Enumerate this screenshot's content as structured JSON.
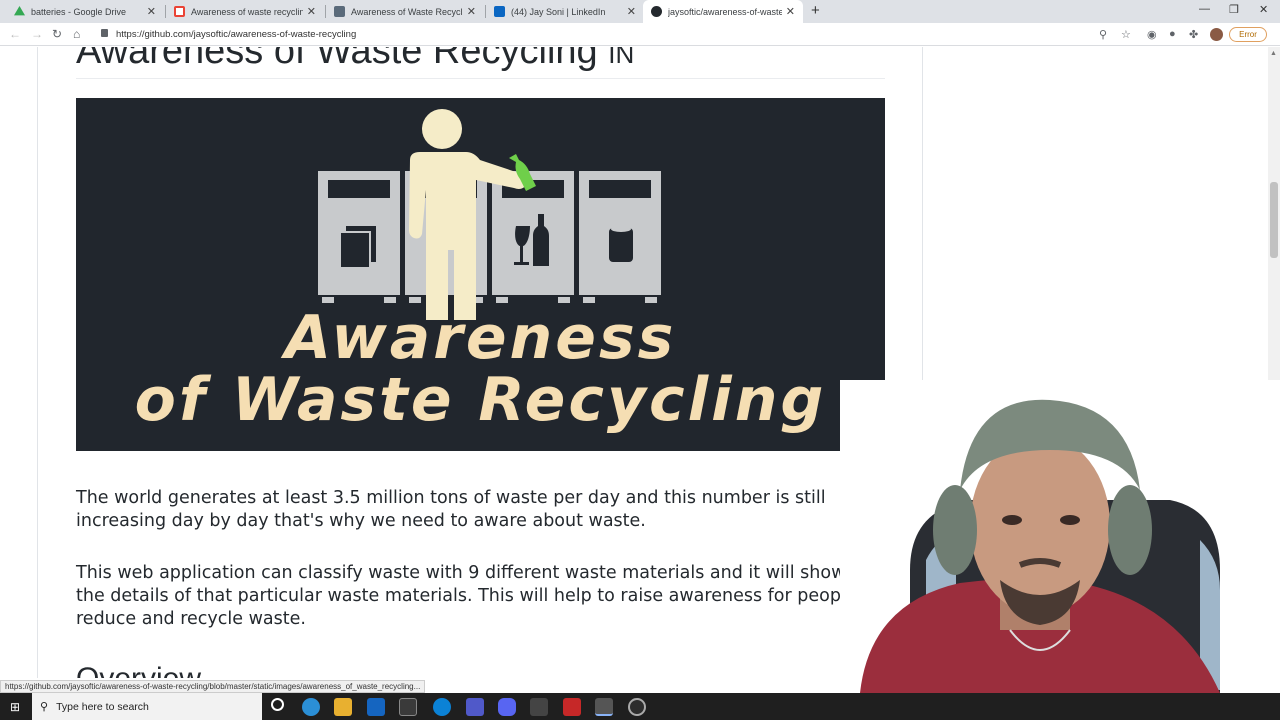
{
  "tabs": [
    {
      "title": "batteries - Google Drive",
      "icon": "google-drive-icon",
      "color": "#34a853"
    },
    {
      "title": "Awareness of waste recycling de",
      "icon": "gmail-icon",
      "color": "#ea4335"
    },
    {
      "title": "Awareness of Waste Recycling",
      "icon": "document-icon",
      "color": "#5a6a7a"
    },
    {
      "title": "(44) Jay Soni | LinkedIn",
      "icon": "linkedin-icon",
      "color": "#0a66c2"
    },
    {
      "title": "jaysoftic/awareness-of-waste-rec",
      "icon": "github-icon",
      "color": "#24292e"
    }
  ],
  "address_bar": {
    "url": "https://github.com/jaysoftic/awareness-of-waste-recycling",
    "error_label": "Error"
  },
  "page": {
    "heading": "Awareness of Waste Recycling",
    "heading_suffix": "IN",
    "banner": {
      "line1": "Awareness",
      "line2": "of Waste Recycling"
    },
    "paragraph1": "The world generates at least 3.5 million tons of waste per day and this number is still increasing day by day that's why we need to aware about waste.",
    "paragraph2": "This web application can classify waste with 9 different waste materials and it will show you the details of that particular waste materials. This will help to raise awareness for people to reduce and recycle waste.",
    "overview_heading": "Overview"
  },
  "status_bar": {
    "link": "https://github.com/jaysoftic/awareness-of-waste-recycling/blob/master/static/images/awareness_of_waste_recycling..."
  },
  "taskbar": {
    "search_placeholder": "Type here to search"
  },
  "colors": {
    "banner_bg": "#21262d",
    "banner_text": "#f5deb3",
    "bottle_green": "#6fcf4a"
  }
}
